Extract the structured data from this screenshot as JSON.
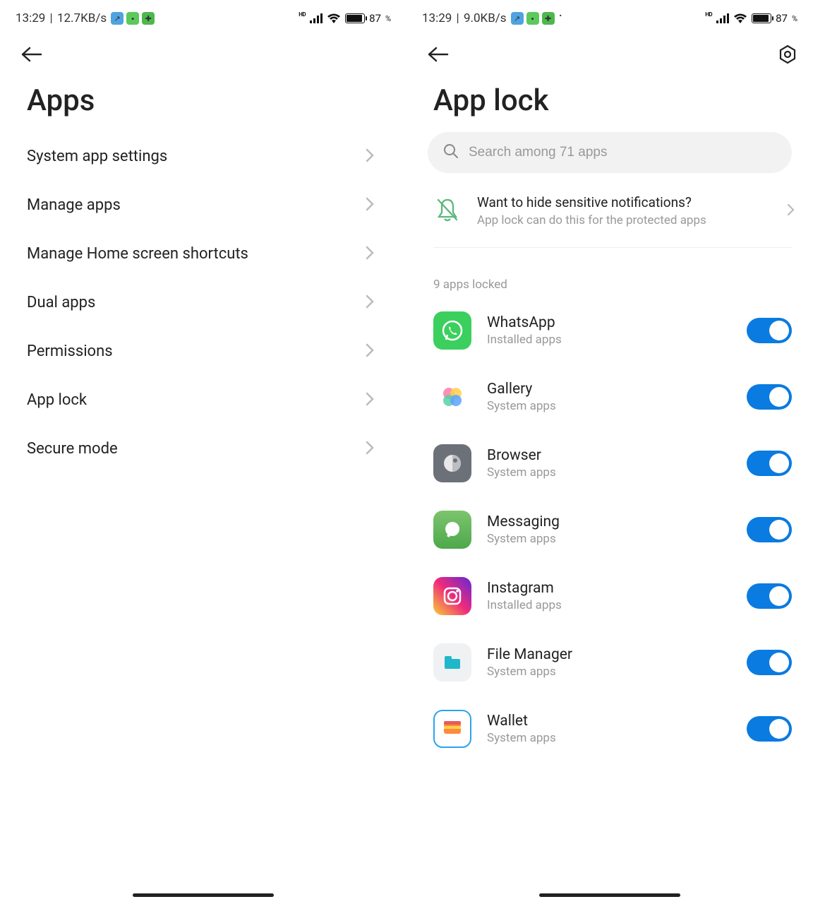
{
  "left": {
    "status": {
      "time": "13:29",
      "speed": "12.7KB/s",
      "battery": "87",
      "pct": "%"
    },
    "title": "Apps",
    "menu": [
      {
        "label": "System app settings"
      },
      {
        "label": "Manage apps"
      },
      {
        "label": "Manage Home screen shortcuts"
      },
      {
        "label": "Dual apps"
      },
      {
        "label": "Permissions"
      },
      {
        "label": "App lock"
      },
      {
        "label": "Secure mode"
      }
    ]
  },
  "right": {
    "status": {
      "time": "13:29",
      "speed": "9.0KB/s",
      "battery": "87",
      "pct": "%"
    },
    "title": "App lock",
    "search_placeholder": "Search among 71 apps",
    "notice": {
      "title": "Want to hide sensitive notifications?",
      "sub": "App lock can do this for the protected apps"
    },
    "section_label": "9 apps locked",
    "apps": [
      {
        "name": "WhatsApp",
        "sub": "Installed apps",
        "icon": "whatsapp"
      },
      {
        "name": "Gallery",
        "sub": "System apps",
        "icon": "gallery"
      },
      {
        "name": "Browser",
        "sub": "System apps",
        "icon": "browser"
      },
      {
        "name": "Messaging",
        "sub": "System apps",
        "icon": "messaging"
      },
      {
        "name": "Instagram",
        "sub": "Installed apps",
        "icon": "instagram"
      },
      {
        "name": "File Manager",
        "sub": "System apps",
        "icon": "fileman"
      },
      {
        "name": "Wallet",
        "sub": "System apps",
        "icon": "wallet"
      }
    ]
  }
}
